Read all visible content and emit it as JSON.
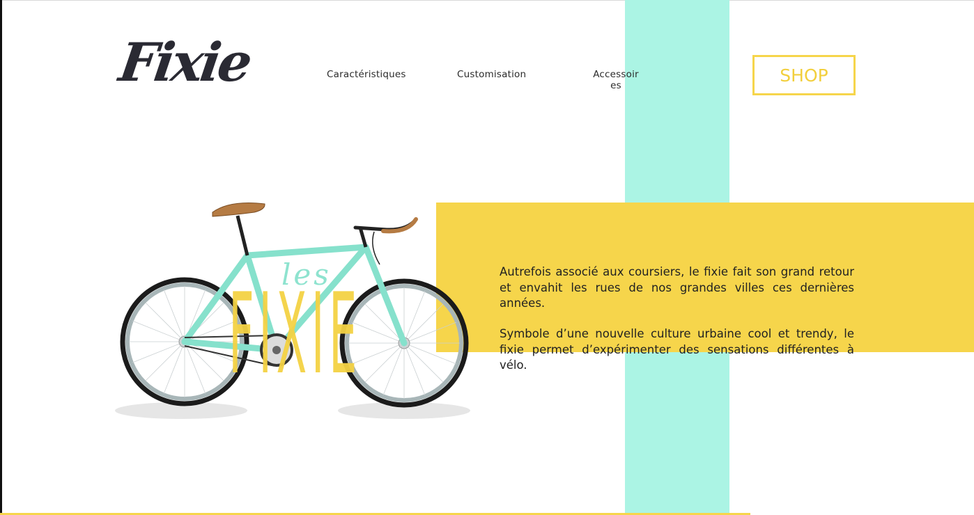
{
  "brand": {
    "logo_text": "Fixie"
  },
  "nav": {
    "items": [
      {
        "label": "Caractéristiques"
      },
      {
        "label": "Customisation"
      },
      {
        "label": "Accessoires"
      }
    ]
  },
  "shop_button": {
    "label": "SHOP"
  },
  "hero": {
    "overlay_small": "les",
    "overlay_large": "FIXIE",
    "paragraphs": [
      "Autrefois associé aux coursiers, le fixie fait son grand retour et envahit les rues de nos grandes villes ces dernières années.",
      "Symbole d’une nouvelle culture urbaine cool et trendy, le fixie permet d’expérimenter des sensations différentes à vélo."
    ]
  },
  "colors": {
    "mint": "#abf4e4",
    "yellow": "#f6d54b",
    "shop_yellow": "#f2cf3d",
    "bike_frame": "#86e1cc",
    "text_dark": "#222222"
  }
}
